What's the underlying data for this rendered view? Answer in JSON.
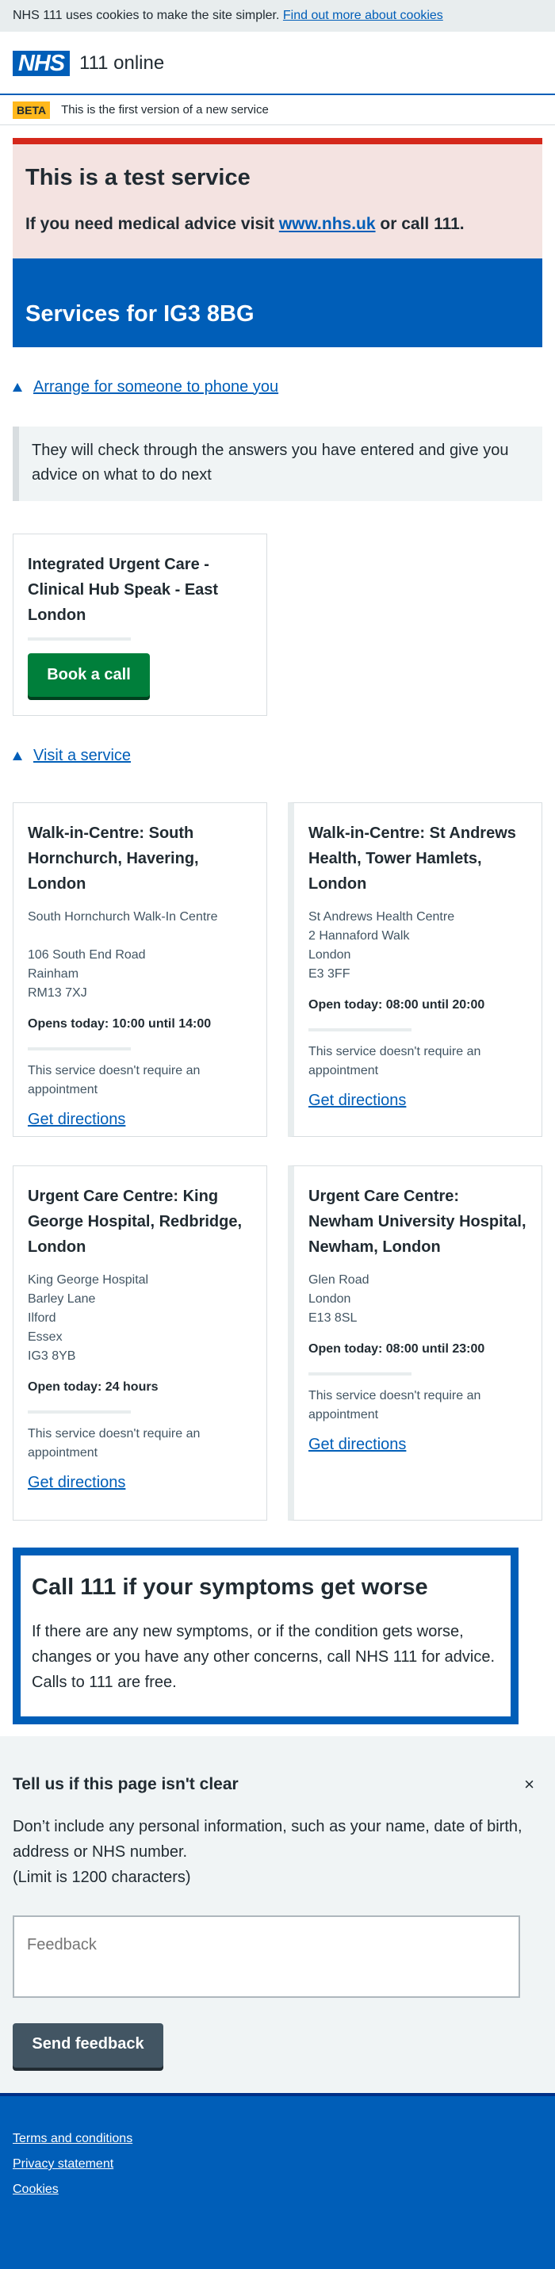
{
  "cookie_banner": {
    "text": "NHS 111 uses cookies to make the site simpler.",
    "link": "Find out more about cookies"
  },
  "header": {
    "logo": "NHS",
    "service_name": "111 online"
  },
  "beta": {
    "tag": "BETA",
    "text": "This is the first version of a new service"
  },
  "test_service": {
    "title": "This is a test service",
    "text_before": "If you need medical advice visit",
    "link": "www.nhs.uk",
    "text_after": "or call 111."
  },
  "services_heading": "Services for IG3 8BG",
  "phone_section": {
    "toggle_label": "Arrange for someone to phone you",
    "inset": "They will check through the answers you have entered and give you advice on what to do next",
    "card": {
      "title": "Integrated Urgent Care - Clinical Hub Speak - East London",
      "button": "Book a call"
    }
  },
  "visit_section": {
    "toggle_label": "Visit a service",
    "cards": [
      {
        "title": "Walk-in-Centre: South Hornchurch, Havering, London",
        "address": [
          "South Hornchurch Walk-In Centre",
          "",
          "106 South End Road",
          "Rainham",
          "RM13 7XJ"
        ],
        "hours": "Opens today: 10:00 until 14:00",
        "note": "This service doesn't require an appointment",
        "directions": "Get directions"
      },
      {
        "title": "Walk-in-Centre: St Andrews Health, Tower Hamlets, London",
        "address": [
          "St Andrews Health Centre",
          "2 Hannaford Walk",
          "London",
          "E3 3FF"
        ],
        "hours": "Open today: 08:00 until 20:00",
        "note": "This service doesn't require an appointment",
        "directions": "Get directions"
      },
      {
        "title": "Urgent Care Centre: King George Hospital, Redbridge, London",
        "address": [
          "King George Hospital",
          "Barley Lane",
          "Ilford",
          "Essex",
          "IG3 8YB"
        ],
        "hours": "Open today: 24 hours",
        "note": "This service doesn't require an appointment",
        "directions": "Get directions"
      },
      {
        "title": "Urgent Care Centre: Newham University Hospital, Newham, London",
        "address": [
          "Glen Road",
          "London",
          "E13 8SL"
        ],
        "hours": "Open today: 08:00 until 23:00",
        "note": "This service doesn't require an appointment",
        "directions": "Get directions"
      }
    ]
  },
  "call111": {
    "title": "Call 111 if your symptoms get worse",
    "text": "If there are any new symptoms, or if the condition gets worse, changes or you have any other concerns, call NHS 111 for advice. Calls to 111 are free."
  },
  "feedback": {
    "title": "Tell us if this page isn't clear",
    "close": "×",
    "info": "Don’t include any personal information, such as your name, date of birth, address or NHS number.",
    "limit": "(Limit is 1200 characters)",
    "placeholder": "Feedback",
    "button": "Send feedback"
  },
  "footer": {
    "links": [
      "Terms and conditions",
      "Privacy statement",
      "Cookies"
    ]
  }
}
